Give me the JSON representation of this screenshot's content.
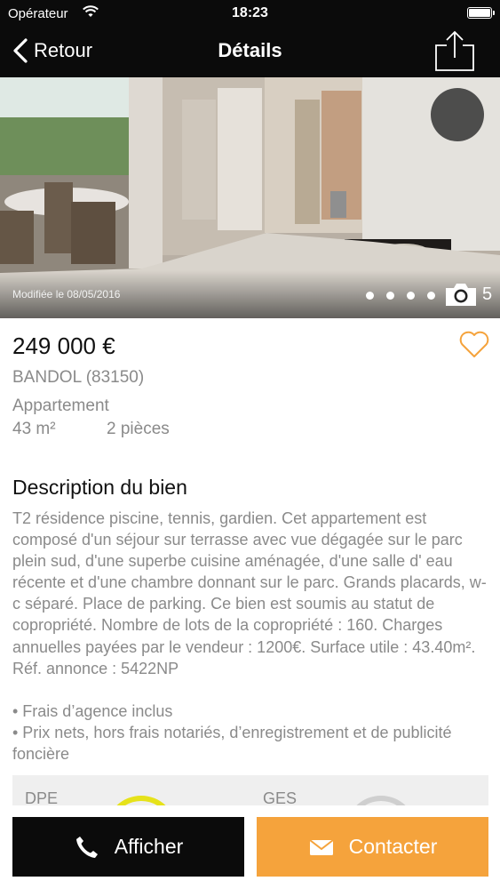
{
  "status_bar": {
    "carrier": "Opérateur",
    "time": "18:23"
  },
  "nav": {
    "back_label": "Retour",
    "title": "Détails"
  },
  "photo": {
    "modified": "Modifiée le 08/05/2016",
    "photo_count": "5"
  },
  "listing": {
    "price": "249 000 €",
    "city": "BANDOL (83150)",
    "property_type": "Appartement",
    "surface": "43 m²",
    "rooms": "2 pièces"
  },
  "description": {
    "title": "Description du bien",
    "text": "T2 résidence piscine, tennis, gardien. Cet appartement est composé d'un séjour sur terrasse avec vue dégagée sur le parc plein sud, d'une superbe cuisine aménagée, d'une salle d' eau récente et d'une chambre donnant sur le parc. Grands placards, w-c séparé. Place de parking. Ce bien est soumis au statut de copropriété. Nombre de lots de la copropriété : 160. Charges annuelles payées par le vendeur : 1200€. Surface utile : 43.40m². Réf. annonce : 5422NP",
    "bullets": [
      "• Frais d’agence inclus",
      "• Prix nets, hors frais notariés, d’enregistrement et de publicité foncière"
    ]
  },
  "energy": {
    "dpe_label": "DPE",
    "ges_label": "GES"
  },
  "footer": {
    "show_label": "Afficher",
    "contact_label": "Contacter"
  },
  "colors": {
    "accent": "#f5a33c",
    "dark": "#0b0b0b",
    "muted_text": "#8a8a8a",
    "dpe_gauge": "#e6e21a"
  }
}
